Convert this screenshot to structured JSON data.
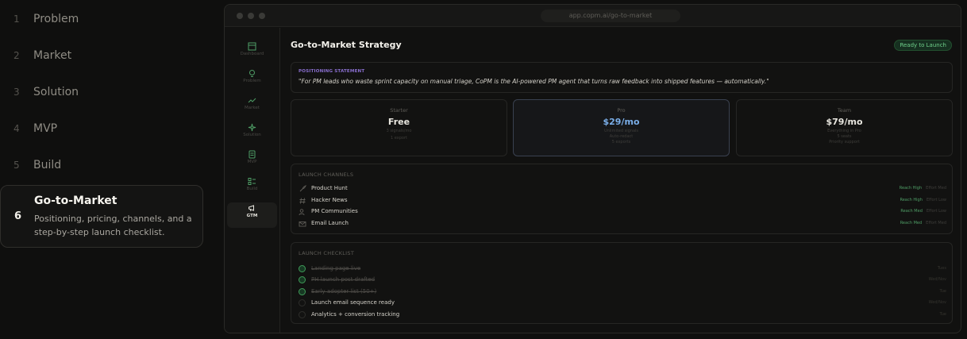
{
  "steps": [
    {
      "num": "1",
      "label": "Problem"
    },
    {
      "num": "2",
      "label": "Market"
    },
    {
      "num": "3",
      "label": "Solution"
    },
    {
      "num": "4",
      "label": "MVP"
    },
    {
      "num": "5",
      "label": "Build"
    },
    {
      "num": "6",
      "label": "Go-to-Market",
      "desc": "Positioning, pricing, channels, and a step-by-step launch checklist."
    }
  ],
  "window": {
    "url": "app.copm.ai/go-to-market"
  },
  "rail": [
    {
      "label": "Dashboard",
      "icon": "dashboard-icon"
    },
    {
      "label": "Problem",
      "icon": "lightbulb-icon"
    },
    {
      "label": "Market",
      "icon": "trend-icon"
    },
    {
      "label": "Solution",
      "icon": "sparkle-icon"
    },
    {
      "label": "MVP",
      "icon": "document-icon"
    },
    {
      "label": "Build",
      "icon": "checklist-icon"
    },
    {
      "label": "GTM",
      "icon": "megaphone-icon"
    }
  ],
  "page": {
    "title": "Go-to-Market Strategy",
    "badge": "Ready to Launch",
    "positioning_caption": "POSITIONING STATEMENT",
    "positioning_quote": "\"For PM leads who waste sprint capacity on manual triage, CoPM is the AI-powered PM agent that turns raw feedback into shipped features — automatically.\""
  },
  "pricing": [
    {
      "tier": "Starter",
      "price": "Free",
      "features": [
        "3 signals/mo",
        "1 export"
      ]
    },
    {
      "tier": "Pro",
      "price": "$29/mo",
      "features": [
        "Unlimited signals",
        "Auto-redact",
        "5 exports"
      ]
    },
    {
      "tier": "Team",
      "price": "$79/mo",
      "features": [
        "Everything in Pro",
        "5 seats",
        "Priority support"
      ]
    }
  ],
  "channels": {
    "title": "LAUNCH CHANNELS",
    "items": [
      {
        "name": "Product Hunt",
        "reach": "Reach High",
        "effort": "Effort Med"
      },
      {
        "name": "Hacker News",
        "reach": "Reach High",
        "effort": "Effort Low"
      },
      {
        "name": "PM Communities",
        "reach": "Reach Med",
        "effort": "Effort Low"
      },
      {
        "name": "Email Launch",
        "reach": "Reach Med",
        "effort": "Effort Med"
      }
    ]
  },
  "checklist": {
    "title": "LAUNCH CHECKLIST",
    "items": [
      {
        "text": "Landing page live",
        "when": "Tues"
      },
      {
        "text": "PH launch post drafted",
        "when": "Wed/Nov"
      },
      {
        "text": "Early adopter list (50+)",
        "when": "Tue"
      },
      {
        "text": "Launch email sequence ready",
        "when": "Wed/Nov"
      },
      {
        "text": "Analytics + conversion tracking",
        "when": "Tue"
      }
    ]
  },
  "colors": {
    "accent_green": "#6fd08a",
    "accent_blue": "#7aaee8",
    "accent_purple": "#8a6fd0"
  }
}
